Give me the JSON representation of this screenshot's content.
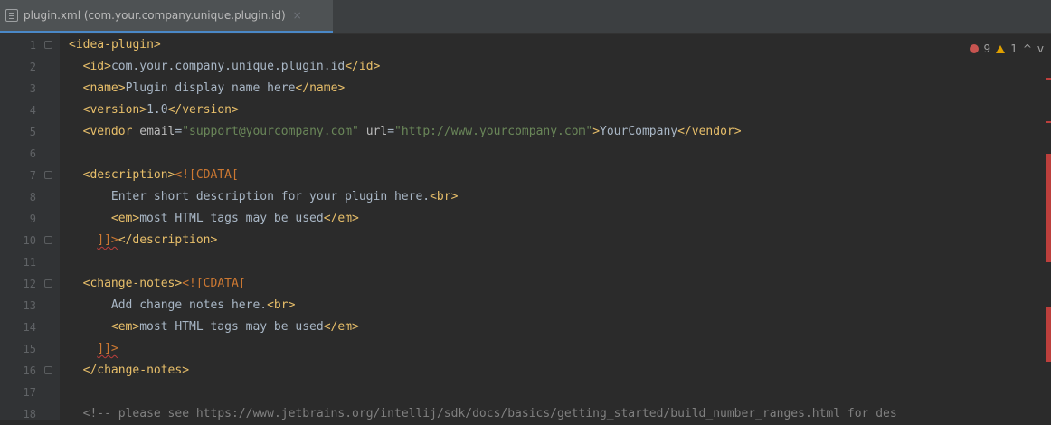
{
  "tab": {
    "title": "plugin.xml (com.your.company.unique.plugin.id)",
    "close": "×",
    "icon": "xml-file-icon"
  },
  "inspections": {
    "errors": "9",
    "warnings": "1",
    "up": "^",
    "down": "v"
  },
  "colors": {
    "tag": "#e8bf6a",
    "string": "#6a8759",
    "text": "#a9b7c6",
    "error": "#c75450",
    "warning": "#e0a000",
    "accent": "#4a88c7"
  },
  "lines": [
    {
      "n": "1",
      "code": "<idea-plugin>"
    },
    {
      "n": "2",
      "code": "<id>com.your.company.unique.plugin.id</id>"
    },
    {
      "n": "3",
      "code": "<name>Plugin display name here</name>"
    },
    {
      "n": "4",
      "code": "<version>1.0</version>"
    },
    {
      "n": "5",
      "code": "<vendor email=\"support@yourcompany.com\" url=\"http://www.yourcompany.com\">YourCompany</vendor>"
    },
    {
      "n": "6",
      "code": ""
    },
    {
      "n": "7",
      "code": "<description><![CDATA["
    },
    {
      "n": "8",
      "code": "Enter short description for your plugin here.<br>"
    },
    {
      "n": "9",
      "code": "<em>most HTML tags may be used</em>"
    },
    {
      "n": "10",
      "code": "]]></description>"
    },
    {
      "n": "11",
      "code": ""
    },
    {
      "n": "12",
      "code": "<change-notes><![CDATA["
    },
    {
      "n": "13",
      "code": "Add change notes here.<br>"
    },
    {
      "n": "14",
      "code": "<em>most HTML tags may be used</em>"
    },
    {
      "n": "15",
      "code": "]]>"
    },
    {
      "n": "16",
      "code": "</change-notes>"
    },
    {
      "n": "17",
      "code": ""
    },
    {
      "n": "18",
      "code": "<!-- please see https://www.jetbrains.org/intellij/sdk/docs/basics/getting_started/build_number_ranges.html for des"
    }
  ]
}
